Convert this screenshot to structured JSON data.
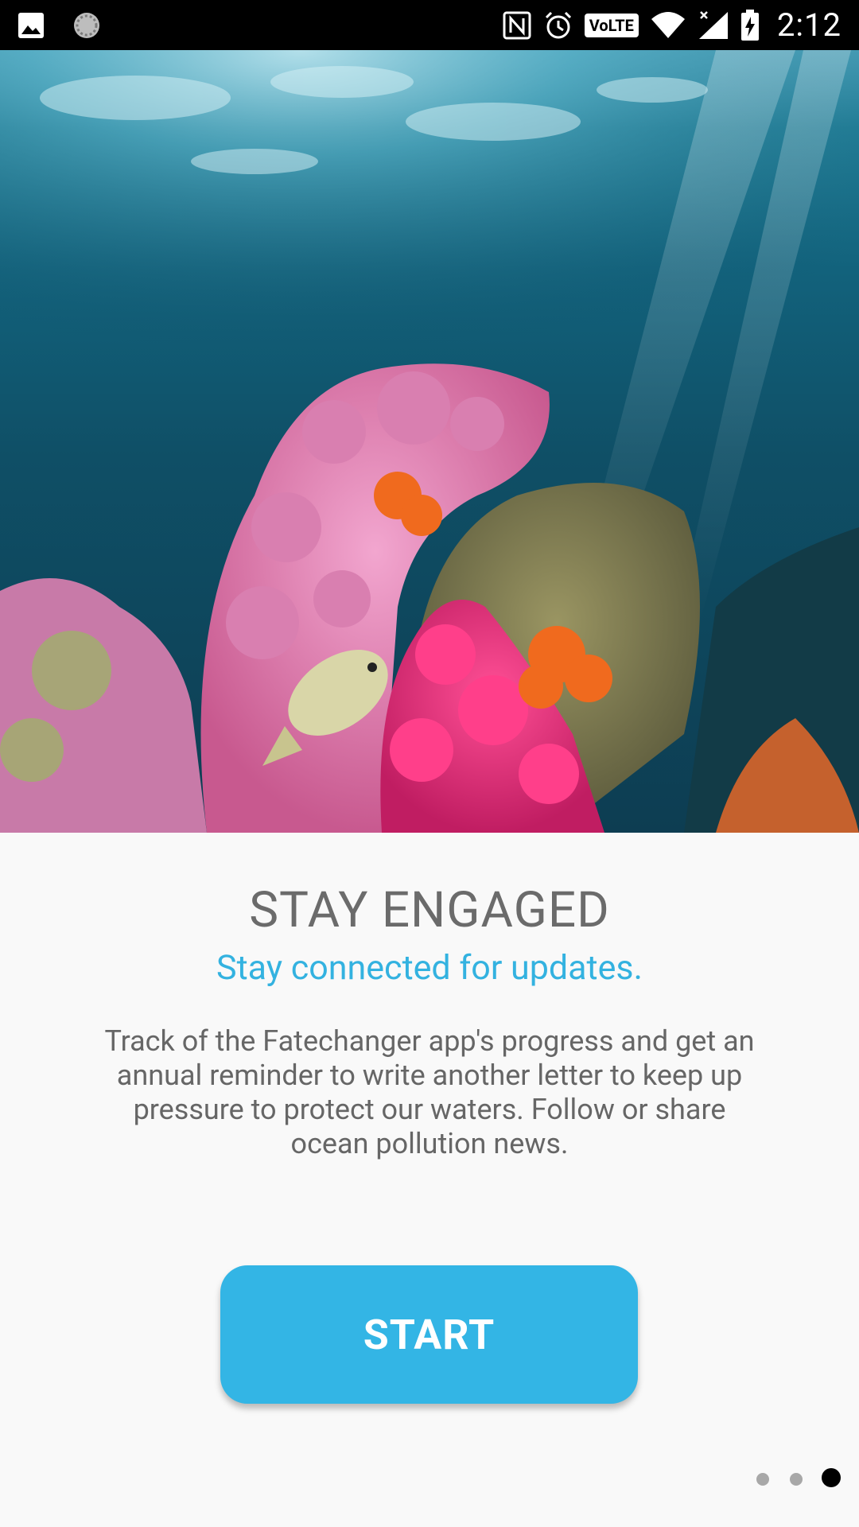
{
  "status_bar": {
    "time": "2:12",
    "volte_label": "VoLTE",
    "icons": [
      "image-icon",
      "sync-icon",
      "nfc-icon",
      "alarm-icon",
      "volte-icon",
      "wifi-icon",
      "signal-icon",
      "battery-charging-icon"
    ]
  },
  "hero": {
    "image_description": "underwater coral reef with fish",
    "colors": {
      "water_top": "#4aa6c0",
      "water_deep": "#0d3d52",
      "coral_pink": "#e0357a",
      "coral_orange": "#f06a1e"
    }
  },
  "onboarding": {
    "title": "STAY ENGAGED",
    "subtitle": "Stay connected for updates.",
    "body": "Track of the Fatechanger app's progress and get an annual reminder to write another letter to keep up pressure to protect our waters. Follow or share ocean pollution news.",
    "start_label": "START"
  },
  "pager": {
    "page_count": 3,
    "current_page": 3
  },
  "colors": {
    "accent": "#33b5e5",
    "title_text": "#6b6b6b",
    "body_text": "#666666",
    "background": "#f9f9f9"
  }
}
